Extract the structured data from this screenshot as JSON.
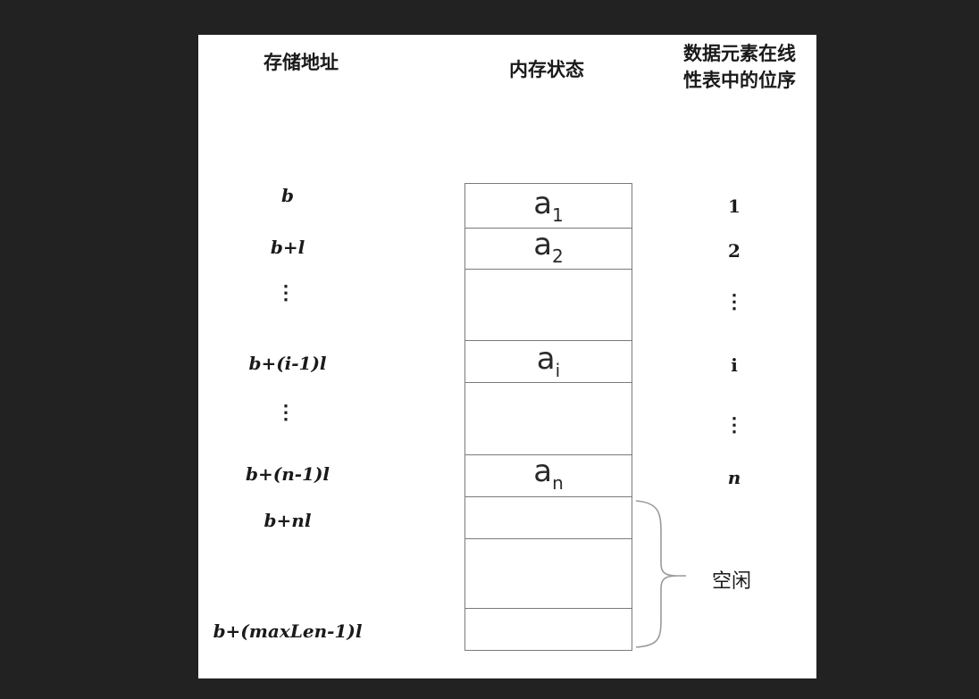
{
  "headers": {
    "address": "存储地址",
    "memory": "内存状态",
    "order_line1": "数据元素在线",
    "order_line2": "性表中的位序"
  },
  "addresses": {
    "a1": "b",
    "a2": "b+l",
    "dots1": "⋮",
    "ai": "b+(i-1)l",
    "dots2": "⋮",
    "an": "b+(n-1)l",
    "next": "b+nl",
    "last": "b+(maxLen-1)l"
  },
  "elements": {
    "a1": {
      "base": "a",
      "sub": "1"
    },
    "a2": {
      "base": "a",
      "sub": "2"
    },
    "ai": {
      "base": "a",
      "sub": "i"
    },
    "an": {
      "base": "a",
      "sub": "n"
    }
  },
  "orders": {
    "a1": "1",
    "a2": "2",
    "dots1": "⋮",
    "ai": "i",
    "dots2": "⋮",
    "an": "n"
  },
  "free_label": "空闲"
}
